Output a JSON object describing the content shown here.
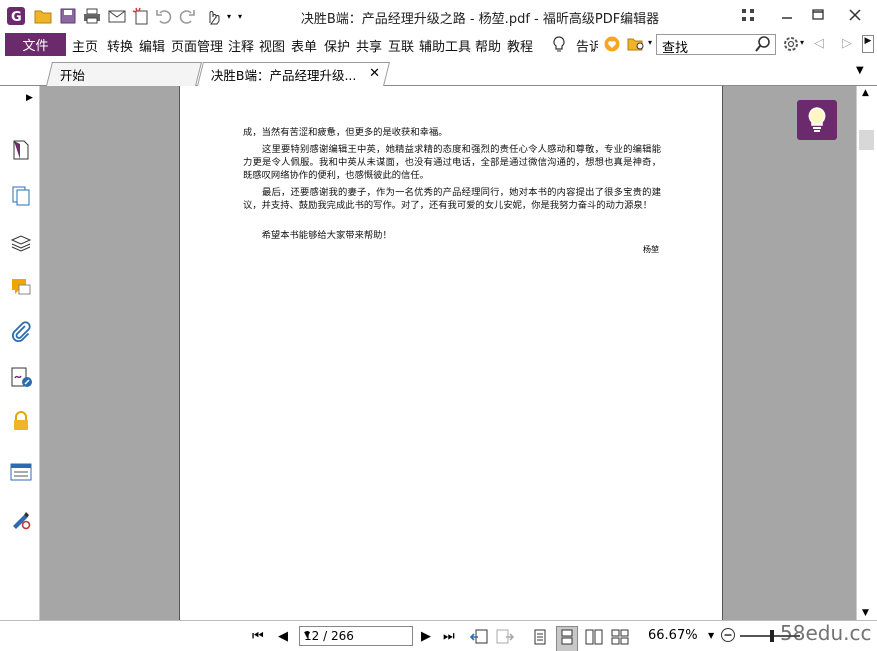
{
  "window": {
    "title": "决胜B端：产品经理升级之路 - 杨堃.pdf - 福昕高级PDF编辑器"
  },
  "menu": {
    "file": "文件",
    "items": [
      "主页",
      "转换",
      "编辑",
      "页面管理",
      "注释",
      "视图",
      "表单",
      "保护",
      "共享",
      "互联",
      "辅助工具",
      "帮助",
      "教程"
    ],
    "tell": "告诉",
    "search_placeholder": "查找"
  },
  "tabs": [
    {
      "label": "开始"
    },
    {
      "label": "决胜B端：产品经理升级..."
    }
  ],
  "document": {
    "paragraphs": [
      "成，当然有苦涩和疲惫，但更多的是收获和幸福。",
      "　　这里要特别感谢编辑王中英，她精益求精的态度和强烈的责任心令人感动和尊敬，专业的编辑能力更是令人佩服。我和中英从未谋面，也没有通过电话，全部是通过微信沟通的，想想也真是神奇，既感叹网络协作的便利，也感慨彼此的信任。",
      "　　最后，还要感谢我的妻子，作为一名优秀的产品经理同行，她对本书的内容提出了很多宝贵的建议，并支持、鼓励我完成此书的写作。对了，还有我可爱的女儿安妮，你是我努力奋斗的动力源泉！",
      "　　希望本书能够给大家带来帮助！"
    ],
    "signature": "杨堃"
  },
  "status": {
    "page": "12 / 266",
    "zoom": "66.67%",
    "watermark": "58edu.cc"
  }
}
